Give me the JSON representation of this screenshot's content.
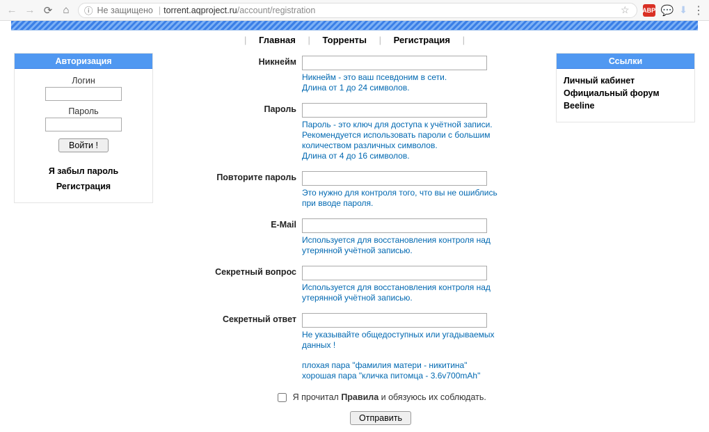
{
  "browser": {
    "insecure_label": "Не защищено",
    "url_host": "torrent.aqproject.ru",
    "url_path": "/account/registration",
    "abp_label": "ABP"
  },
  "nav": {
    "home": "Главная",
    "torrents": "Торренты",
    "registration": "Регистрация"
  },
  "auth_panel": {
    "title": "Авторизация",
    "login_label": "Логин",
    "password_label": "Пароль",
    "login_value": "",
    "password_value": "",
    "submit_label": "Войти !",
    "forgot": "Я забыл пароль",
    "register": "Регистрация"
  },
  "links_panel": {
    "title": "Ссылки",
    "items": [
      "Личный кабинет",
      "Официальный форум Beeline"
    ]
  },
  "form": {
    "nick": {
      "label": "Никнейм",
      "hint": "Никнейм - это ваш псевдоним в сети.\nДлина от 1 до 24 символов."
    },
    "password": {
      "label": "Пароль",
      "hint": "Пароль - это ключ для доступа к учётной записи.\nРекомендуется использовать пароли с большим количеством различных символов.\nДлина от 4 до 16 символов."
    },
    "password2": {
      "label": "Повторите пароль",
      "hint": "Это нужно для контроля того, что вы не ошиблись при вводе пароля."
    },
    "email": {
      "label": "E-Mail",
      "hint": "Используется для восстановления контроля над утерянной учётной записью."
    },
    "question": {
      "label": "Секретный вопрос",
      "hint": "Используется для восстановления контроля над утерянной учётной записью."
    },
    "answer": {
      "label": "Секретный ответ",
      "hint_1": "Не указывайте общедоступных или угадываемых данных !",
      "hint_2": "плохая пара \"фамилия матери - никитина\"\nхорошая пара \"кличка питомца - 3.6v700mAh\""
    },
    "rules_pre": "Я прочитал ",
    "rules_bold": "Правила",
    "rules_post": " и обязуюсь их соблюдать.",
    "submit": "Отправить"
  }
}
